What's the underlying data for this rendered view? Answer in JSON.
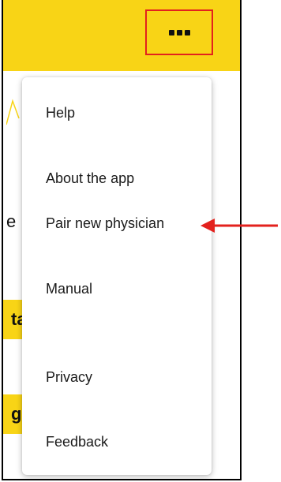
{
  "app_bar": {
    "more_button_icon": "more-horizontal-icon",
    "background_color": "#f8d416",
    "highlight_color": "#e3211d"
  },
  "background": {
    "partial_text": "e",
    "card1_text": "ta",
    "card2_text": "g"
  },
  "menu": {
    "items": [
      {
        "label": "Help"
      },
      {
        "label": "About the app"
      },
      {
        "label": "Pair new physician"
      },
      {
        "label": "Manual"
      },
      {
        "label": "Privacy"
      },
      {
        "label": "Feedback"
      }
    ]
  },
  "annotation": {
    "arrow_color": "#e3211d",
    "points_to": "Pair new physician"
  }
}
